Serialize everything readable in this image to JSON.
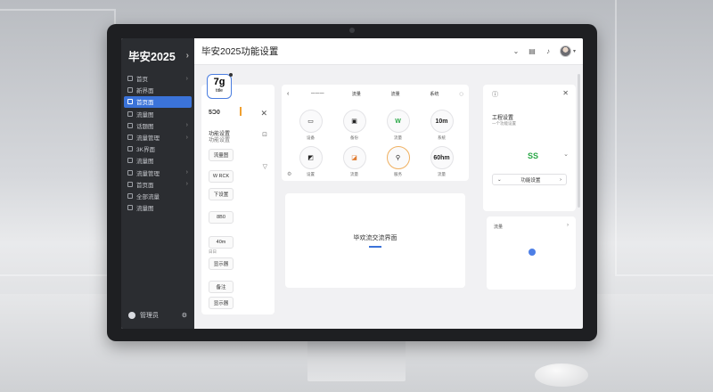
{
  "app": {
    "brand": "毕安2025",
    "page_title": "毕安2025功能设置"
  },
  "sidebar": {
    "items": [
      {
        "label": "首页",
        "active": false
      },
      {
        "label": "新界面",
        "active": false
      },
      {
        "label": "首页面",
        "active": true
      },
      {
        "label": "流量图",
        "active": false
      },
      {
        "label": "话题图",
        "active": false
      },
      {
        "label": "流量管理",
        "active": false
      },
      {
        "label": "3K界面",
        "active": false
      },
      {
        "label": "流量图",
        "active": false
      },
      {
        "label": "流量管理",
        "active": false
      },
      {
        "label": "首页面",
        "active": false
      },
      {
        "label": "全部流量",
        "active": false
      },
      {
        "label": "流量图",
        "active": false
      }
    ],
    "footer_user": "管理员"
  },
  "left_panel": {
    "logo_text": "7g",
    "logo_sub": "title",
    "heading": "5Ɔ0",
    "line1": "功能设置",
    "line2": "功能设置",
    "chips": [
      "流量图",
      "W RCK",
      "下设置",
      "8B0",
      "40m",
      "显示器",
      "备注",
      "显示器"
    ],
    "chip_sub": "日日"
  },
  "center_top": {
    "tabs": [
      "一一一",
      "流量",
      "流量",
      "系统"
    ],
    "grid": [
      {
        "glyph": "▭",
        "label": "设备"
      },
      {
        "glyph": "▣",
        "label": "备份"
      },
      {
        "glyph": "W",
        "label": "流量"
      },
      {
        "glyph": "10m",
        "label": "系统"
      },
      {
        "glyph": "◩",
        "label": "设置"
      },
      {
        "glyph": "◪",
        "label": "流量"
      },
      {
        "glyph": "⚲",
        "label": "服务"
      },
      {
        "glyph": "60hm",
        "label": "流量"
      }
    ]
  },
  "right_top": {
    "title": "工程设置",
    "subtitle": "一个功能设置",
    "status_glyph": "SS",
    "button_label": "功能设置"
  },
  "center_bottom": {
    "text": "毕欢流交流界面"
  },
  "right_bottom": {
    "label": "流量"
  }
}
